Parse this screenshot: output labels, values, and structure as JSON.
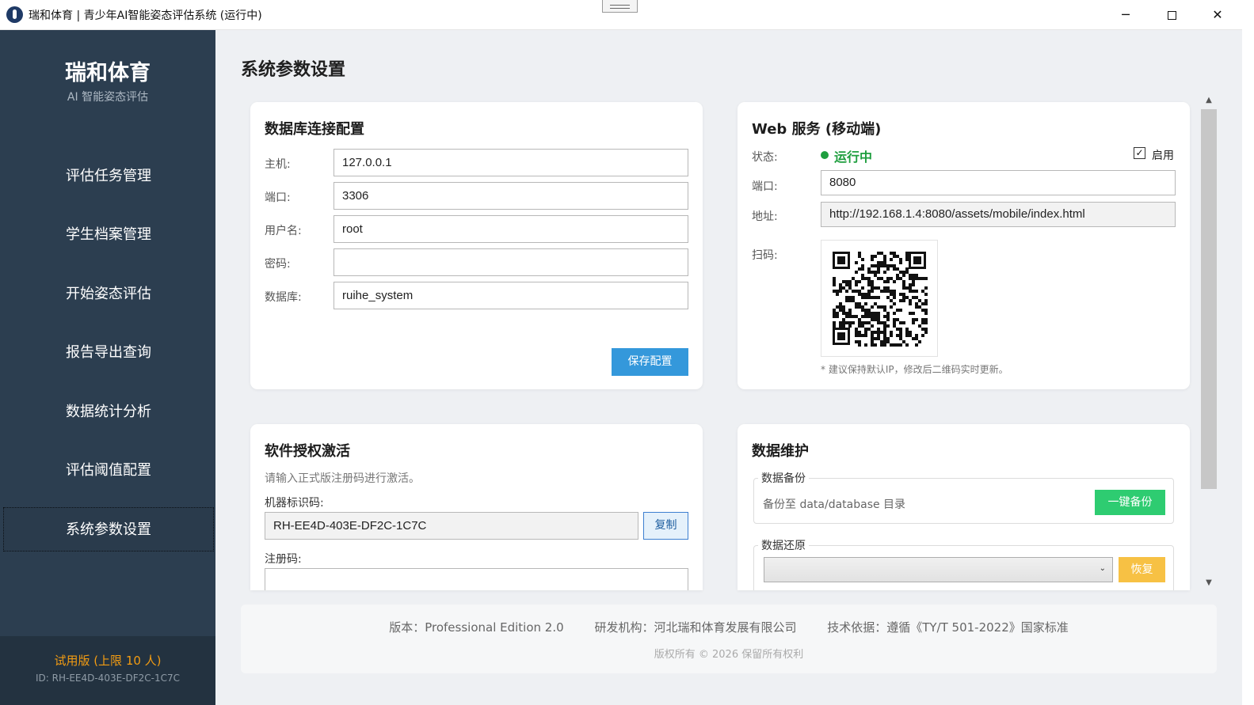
{
  "window": {
    "title": "瑞和体育 | 青少年AI智能姿态评估系统 (运行中)",
    "minimize_glyph": "─",
    "close_glyph": "✕"
  },
  "sidebar": {
    "brand": "瑞和体育",
    "subtitle": "AI 智能姿态评估",
    "items": [
      {
        "label": "评估任务管理"
      },
      {
        "label": "学生档案管理"
      },
      {
        "label": "开始姿态评估"
      },
      {
        "label": "报告导出查询"
      },
      {
        "label": "数据统计分析"
      },
      {
        "label": "评估阈值配置"
      },
      {
        "label": "系统参数设置",
        "active": true
      }
    ],
    "footer": {
      "edition": "试用版 (上限 10 人)",
      "id": "ID: RH-EE4D-403E-DF2C-1C7C"
    }
  },
  "page": {
    "title": "系统参数设置"
  },
  "db_card": {
    "title": "数据库连接配置",
    "host_label": "主机:",
    "host_value": "127.0.0.1",
    "port_label": "端口:",
    "port_value": "3306",
    "user_label": "用户名:",
    "user_value": "root",
    "password_label": "密码:",
    "password_value": "",
    "database_label": "数据库:",
    "database_value": "ruihe_system",
    "save_button": "保存配置"
  },
  "web_card": {
    "title": "Web 服务 (移动端)",
    "status_label": "状态:",
    "status_value": "运行中",
    "status_color": "#1e9e3e",
    "enable_label": "启用",
    "enable_checked": true,
    "enable_check_glyph": "✓",
    "port_label": "端口:",
    "port_value": "8080",
    "address_label": "地址:",
    "address_value": "http://192.168.1.4:8080/assets/mobile/index.html",
    "qr_label": "扫码:",
    "hint": "* 建议保持默认IP，修改后二维码实时更新。"
  },
  "license_card": {
    "title": "软件授权激活",
    "desc": "请输入正式版注册码进行激活。",
    "machine_code_label": "机器标识码:",
    "machine_code_value": "RH-EE4D-403E-DF2C-1C7C",
    "copy_button": "复制",
    "reg_code_label": "注册码:",
    "reg_code_value": ""
  },
  "maint_card": {
    "title": "数据维护",
    "backup_legend": "数据备份",
    "backup_desc": "备份至 data/database 目录",
    "backup_button": "一键备份",
    "restore_legend": "数据还原",
    "restore_selected": "",
    "restore_button": "恢复"
  },
  "footer": {
    "version": "版本：Professional Edition 2.0",
    "org": "研发机构：河北瑞和体育发展有限公司",
    "standard": "技术依据：遵循《TY/T 501-2022》国家标准",
    "copyright": "版权所有 © 2026 保留所有权利"
  },
  "colors": {
    "sidebar_bg": "#2c3e50",
    "primary": "#3498db",
    "success": "#2ecc71",
    "warning": "#f7c144",
    "trial": "#f39c12"
  },
  "scrollbar": {
    "up_glyph": "▲",
    "down_glyph": "▼"
  }
}
